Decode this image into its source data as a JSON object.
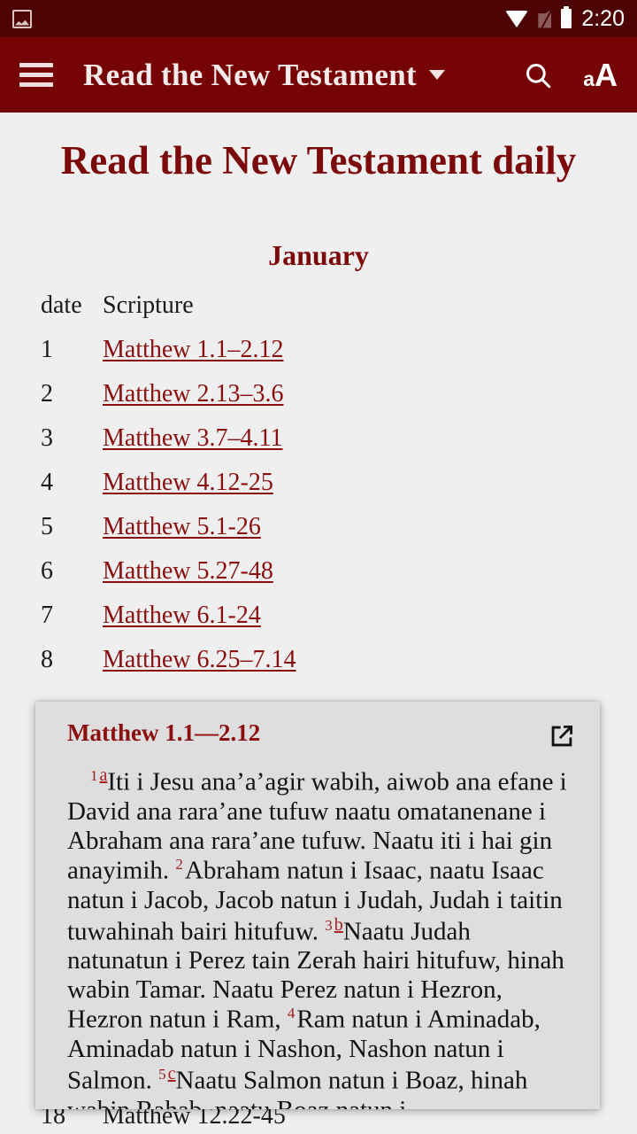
{
  "status_bar": {
    "time": "2:20",
    "icons": [
      "screenshot-image-icon",
      "wifi-icon",
      "no-sim-icon",
      "battery-icon"
    ],
    "background": "#4d0303"
  },
  "app_bar": {
    "background": "#760404",
    "menu_icon": "hamburger-menu-icon",
    "title": "Read the New Testament",
    "dropdown_icon": "chevron-down-icon",
    "search_icon": "search-icon",
    "text_size_icon_small": "a",
    "text_size_icon_big": "A"
  },
  "page": {
    "title": "Read the New Testament daily",
    "month": "January",
    "accent_color": "#7d0a0a",
    "link_color": "#8b0f0f",
    "background": "#efefef",
    "table": {
      "headers": [
        "date",
        "Scripture"
      ],
      "rows": [
        {
          "date": "1",
          "scripture": "Matthew 1.1–2.12"
        },
        {
          "date": "2",
          "scripture": "Matthew 2.13–3.6"
        },
        {
          "date": "3",
          "scripture": "Matthew 3.7–4.11"
        },
        {
          "date": "4",
          "scripture": "Matthew 4.12-25"
        },
        {
          "date": "5",
          "scripture": "Matthew 5.1-26"
        },
        {
          "date": "6",
          "scripture": "Matthew 5.27-48"
        },
        {
          "date": "7",
          "scripture": "Matthew 6.1-24"
        },
        {
          "date": "8",
          "scripture": "Matthew 6.25–7.14"
        }
      ],
      "partially_hidden_row": {
        "date": "18",
        "scripture": "Matthew 12.22-45"
      }
    }
  },
  "preview_card": {
    "background": "#dedede",
    "reference": "Matthew 1.1—2.12",
    "open_icon": "open-in-new-icon",
    "verses": [
      {
        "number": "1",
        "footnote": "a",
        "text": "Iti i Jesu ana’a’agir wabih, aiwob ana efane i David ana rara’ane tufuw naatu omatanenane i Abraham ana rara’ane tufuw. Naatu iti i hai gin anayimih. "
      },
      {
        "number": "2",
        "footnote": "",
        "text": "Abraham natun i Isaac, naatu Isaac natun i Jacob, Jacob natun i Judah, Judah i taitin tuwahinah bairi hitufuw. "
      },
      {
        "number": "3",
        "footnote": "b",
        "text": "Naatu Judah natunatun i Perez tain Zerah hairi hitufuw, hinah wabin Tamar. Naatu Perez natun i Hezron, Hezron natun i Ram, "
      },
      {
        "number": "4",
        "footnote": "",
        "text": "Ram natun i Aminadab, Aminadab natun i Nashon, Nashon natun i Salmon. "
      },
      {
        "number": "5",
        "footnote": "c",
        "text": "Naatu Salmon natun i Boaz, hinah wabin Rahab, naatu Boaz natun i"
      }
    ]
  }
}
